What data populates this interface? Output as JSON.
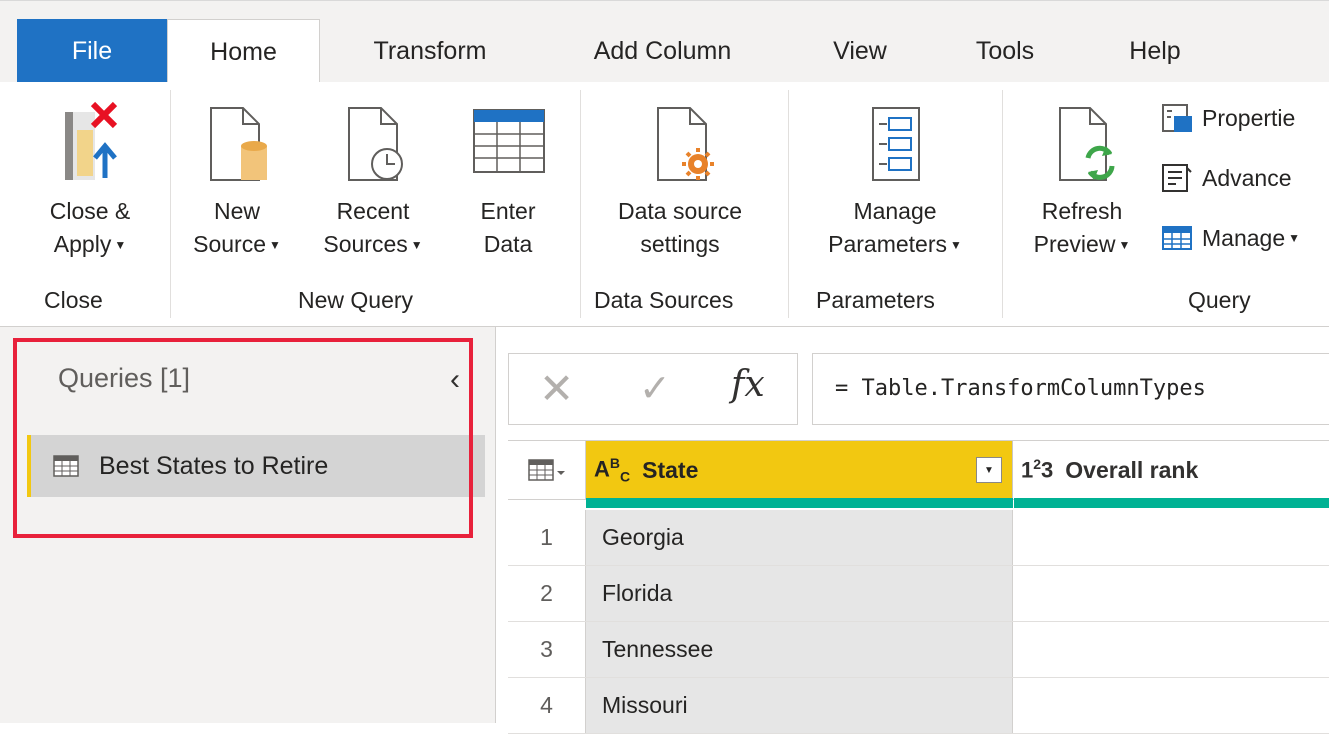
{
  "tabs": {
    "file": "File",
    "home": "Home",
    "transform": "Transform",
    "add_column": "Add Column",
    "view": "View",
    "tools": "Tools",
    "help": "Help"
  },
  "ribbon": {
    "close_group": {
      "label": "Close",
      "close_apply_line1": "Close &",
      "close_apply_line2": "Apply"
    },
    "new_query_group": {
      "label": "New Query",
      "new_source_line1": "New",
      "new_source_line2": "Source",
      "recent_sources_line1": "Recent",
      "recent_sources_line2": "Sources",
      "enter_data_line1": "Enter",
      "enter_data_line2": "Data"
    },
    "data_sources_group": {
      "label": "Data Sources",
      "settings_line1": "Data source",
      "settings_line2": "settings"
    },
    "parameters_group": {
      "label": "Parameters",
      "manage_line1": "Manage",
      "manage_line2": "Parameters"
    },
    "query_group": {
      "label": "Query",
      "refresh_line1": "Refresh",
      "refresh_line2": "Preview",
      "properties": "Propertie",
      "advanced": "Advance",
      "manage": "Manage"
    }
  },
  "queries_pane": {
    "title": "Queries [1]",
    "items": [
      {
        "label": "Best States to Retire"
      }
    ]
  },
  "formula_bar": {
    "fx": "fx",
    "formula": "= Table.TransformColumnTypes"
  },
  "grid": {
    "columns": [
      {
        "type_icon": "ABC",
        "name": "State"
      },
      {
        "type_icon": "123",
        "name": "Overall rank"
      }
    ],
    "rows": [
      {
        "num": "1",
        "state": "Georgia"
      },
      {
        "num": "2",
        "state": "Florida"
      },
      {
        "num": "3",
        "state": "Tennessee"
      },
      {
        "num": "4",
        "state": "Missouri"
      }
    ]
  },
  "colors": {
    "file_tab": "#1f72c4",
    "selected_column": "#f2c811",
    "quality_bar": "#00b294",
    "highlight_box": "#e8213b"
  }
}
